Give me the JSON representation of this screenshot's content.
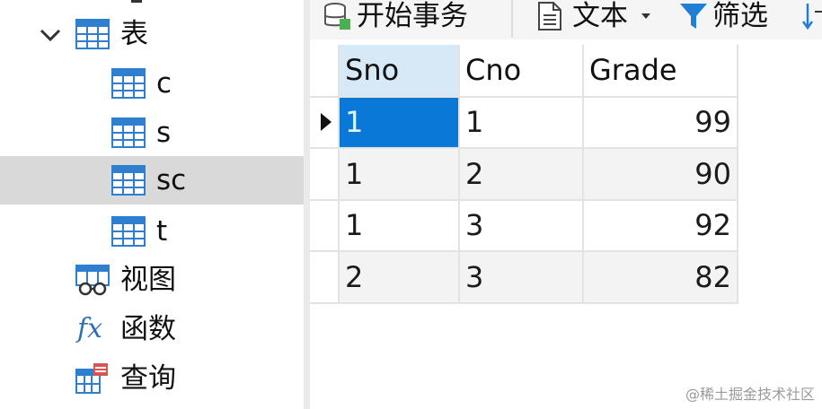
{
  "sidebar": {
    "tables_label": "表",
    "items": [
      {
        "label": "c"
      },
      {
        "label": "s"
      },
      {
        "label": "sc"
      },
      {
        "label": "t"
      }
    ],
    "views_label": "视图",
    "functions_label": "函数",
    "functions_icon_text": "fx",
    "queries_label": "查询"
  },
  "toolbar": {
    "begin_transaction": "开始事务",
    "text": "文本",
    "filter": "筛选"
  },
  "grid": {
    "columns": [
      "Sno",
      "Cno",
      "Grade"
    ],
    "rows": [
      [
        "1",
        "1",
        "99"
      ],
      [
        "1",
        "2",
        "90"
      ],
      [
        "1",
        "3",
        "92"
      ],
      [
        "2",
        "3",
        "82"
      ]
    ]
  },
  "watermark": "@稀土掘金技术社区",
  "colors": {
    "selection": "#0a78d6",
    "header_highlight": "#d7e8f7",
    "tree_selected": "#d9d9d9",
    "table_icon": "#2f7fd1",
    "query_icon_accent": "#d9534f",
    "filter_icon": "#1f7fd6"
  }
}
